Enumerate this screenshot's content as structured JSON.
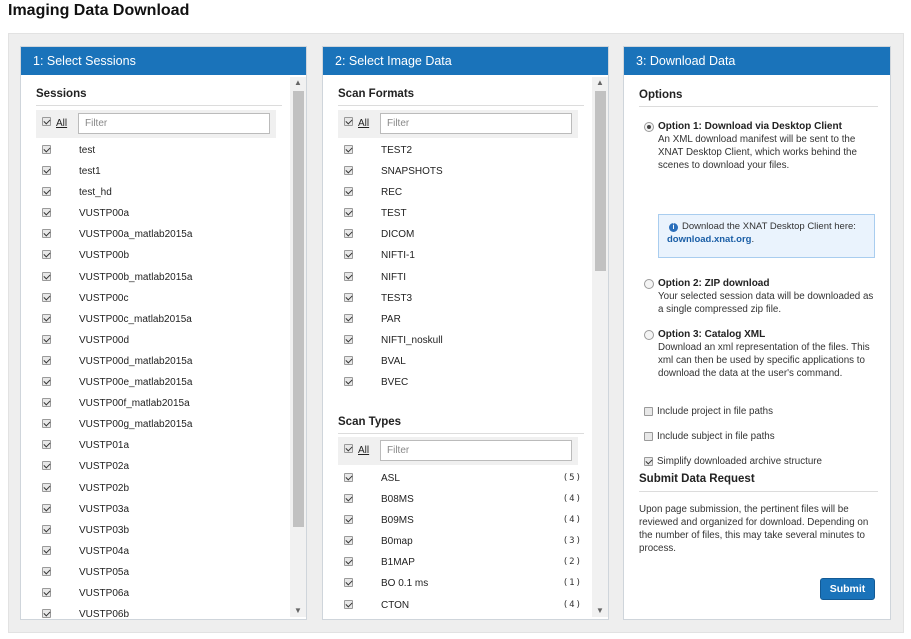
{
  "page_title": "Imaging Data Download",
  "panel1": {
    "header": "1: Select Sessions",
    "section_title": "Sessions",
    "all_label": "All",
    "filter_placeholder": "Filter",
    "items": [
      "test",
      "test1",
      "test_hd",
      "VUSTP00a",
      "VUSTP00a_matlab2015a",
      "VUSTP00b",
      "VUSTP00b_matlab2015a",
      "VUSTP00c",
      "VUSTP00c_matlab2015a",
      "VUSTP00d",
      "VUSTP00d_matlab2015a",
      "VUSTP00e_matlab2015a",
      "VUSTP00f_matlab2015a",
      "VUSTP00g_matlab2015a",
      "VUSTP01a",
      "VUSTP02a",
      "VUSTP02b",
      "VUSTP03a",
      "VUSTP03b",
      "VUSTP04a",
      "VUSTP05a",
      "VUSTP06a",
      "VUSTP06b"
    ]
  },
  "panel2": {
    "header": "2: Select Image Data",
    "formats_title": "Scan Formats",
    "formats_all_label": "All",
    "formats_filter_placeholder": "Filter",
    "formats": [
      "TEST2",
      "SNAPSHOTS",
      "REC",
      "TEST",
      "DICOM",
      "NIFTI-1",
      "NIFTI",
      "TEST3",
      "PAR",
      "NIFTI_noskull",
      "BVAL",
      "BVEC"
    ],
    "types_title": "Scan Types",
    "types_all_label": "All",
    "types_filter_placeholder": "Filter",
    "types": [
      {
        "label": "ASL",
        "count": "(5)"
      },
      {
        "label": "B08MS",
        "count": "(4)"
      },
      {
        "label": "B09MS",
        "count": "(4)"
      },
      {
        "label": "B0map",
        "count": "(3)"
      },
      {
        "label": "B1MAP",
        "count": "(2)"
      },
      {
        "label": "BO 0.1 ms",
        "count": "(1)"
      },
      {
        "label": "CTON",
        "count": "(4)"
      }
    ]
  },
  "panel3": {
    "header": "3: Download Data",
    "options_title": "Options",
    "opt1_title": "Option 1: Download via Desktop Client",
    "opt1_desc": "An XML download manifest will be sent to the XNAT Desktop Client, which works behind the scenes to download your files.",
    "info_text": "Download the XNAT Desktop Client here:",
    "info_link": "download.xnat.org",
    "info_tail": ".",
    "opt2_title": "Option 2: ZIP download",
    "opt2_desc": "Your selected session data will be downloaded as a single compressed zip file.",
    "opt3_title": "Option 3: Catalog XML",
    "opt3_desc": "Download an xml representation of the files. This xml can then be used by specific applications to download the data at the user's command.",
    "chk1": "Include project in file paths",
    "chk2": "Include subject in file paths",
    "chk3": "Simplify downloaded archive structure",
    "submit_title": "Submit Data Request",
    "submit_text": "Upon page submission, the pertinent files will be reviewed and organized for download. Depending on the number of files, this may take several minutes to process.",
    "submit_label": "Submit"
  }
}
